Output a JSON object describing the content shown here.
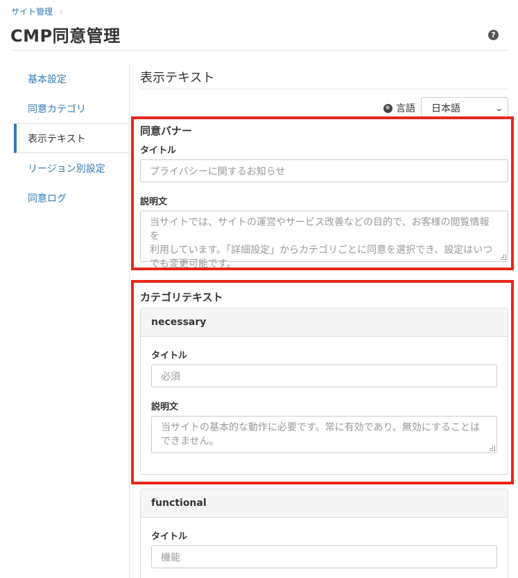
{
  "breadcrumb": {
    "items": [
      "サイト管理"
    ],
    "separator": "›"
  },
  "page": {
    "title": "CMP同意管理",
    "help_icon": "?"
  },
  "sidebar": {
    "items": [
      {
        "label": "基本設定",
        "active": false
      },
      {
        "label": "同意カテゴリ",
        "active": false
      },
      {
        "label": "表示テキスト",
        "active": true
      },
      {
        "label": "リージョン別設定",
        "active": false
      },
      {
        "label": "同意ログ",
        "active": false
      }
    ]
  },
  "main": {
    "title": "表示テキスト",
    "language": {
      "label": "言語",
      "selected": "日本語",
      "icon": "globe-icon"
    },
    "banner": {
      "heading": "同意バナー",
      "title_label": "タイトル",
      "title_placeholder": "プライバシーに関するお知らせ",
      "desc_label": "説明文",
      "desc_placeholder_lines": [
        "当サイトでは、サイトの運営やサービス改善などの目的で、お客様の閲覧情報を",
        "利用しています。「詳細設定」からカテゴリごとに同意を選択でき、設定はいつ",
        "でも変更可能です。"
      ]
    },
    "category_text": {
      "heading": "カテゴリテキスト",
      "categories": [
        {
          "key": "necessary",
          "title_label": "タイトル",
          "title_placeholder": "必須",
          "desc_label": "説明文",
          "desc_placeholder_lines": [
            "当サイトの基本的な動作に必要です。常に有効であり、無効にすることは",
            "できません。"
          ]
        },
        {
          "key": "functional",
          "title_label": "タイトル",
          "title_placeholder": "機能"
        }
      ]
    }
  },
  "colors": {
    "link": "#337ab7",
    "highlight": "#e8261a",
    "panel_heading_bg": "#f5f5f5"
  }
}
